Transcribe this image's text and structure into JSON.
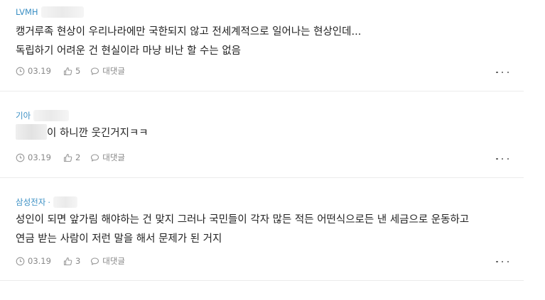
{
  "comments": [
    {
      "author": "LVMH",
      "author_suffix": "",
      "lines": "캥거루족 현상이 우리나라에만 국한되지 않고 전세계적으로 일어나는 현상인데...\n독립하기 어려운 건 현실이라 마냥 비난 할 수는 없음",
      "date": "03.19",
      "likes": "5",
      "reply_label": "대댓글"
    },
    {
      "author": "기아",
      "author_suffix": "",
      "text_after_mask": "이 하니깐 웃긴거지ㅋㅋ",
      "date": "03.19",
      "likes": "2",
      "reply_label": "대댓글"
    },
    {
      "author": "삼성전자",
      "author_suffix": "·",
      "lines": "성인이 되면 앞가림 해야하는 건 맞지 그러나 국민들이 각자 많든 적든 어떤식으로든 낸 세금으로 운동하고\n연금 받는 사람이 저런 말을 해서 문제가 된 거지",
      "date": "03.19",
      "likes": "3",
      "reply_label": "대댓글"
    }
  ],
  "icons": {
    "date": "clock-icon",
    "like": "thumbs-up-icon",
    "reply": "speech-bubble-icon",
    "more": "more-dots-icon"
  },
  "colors": {
    "author": "#3a8fc4",
    "meta": "#888888",
    "text": "#222222",
    "divider": "#ebebeb"
  }
}
